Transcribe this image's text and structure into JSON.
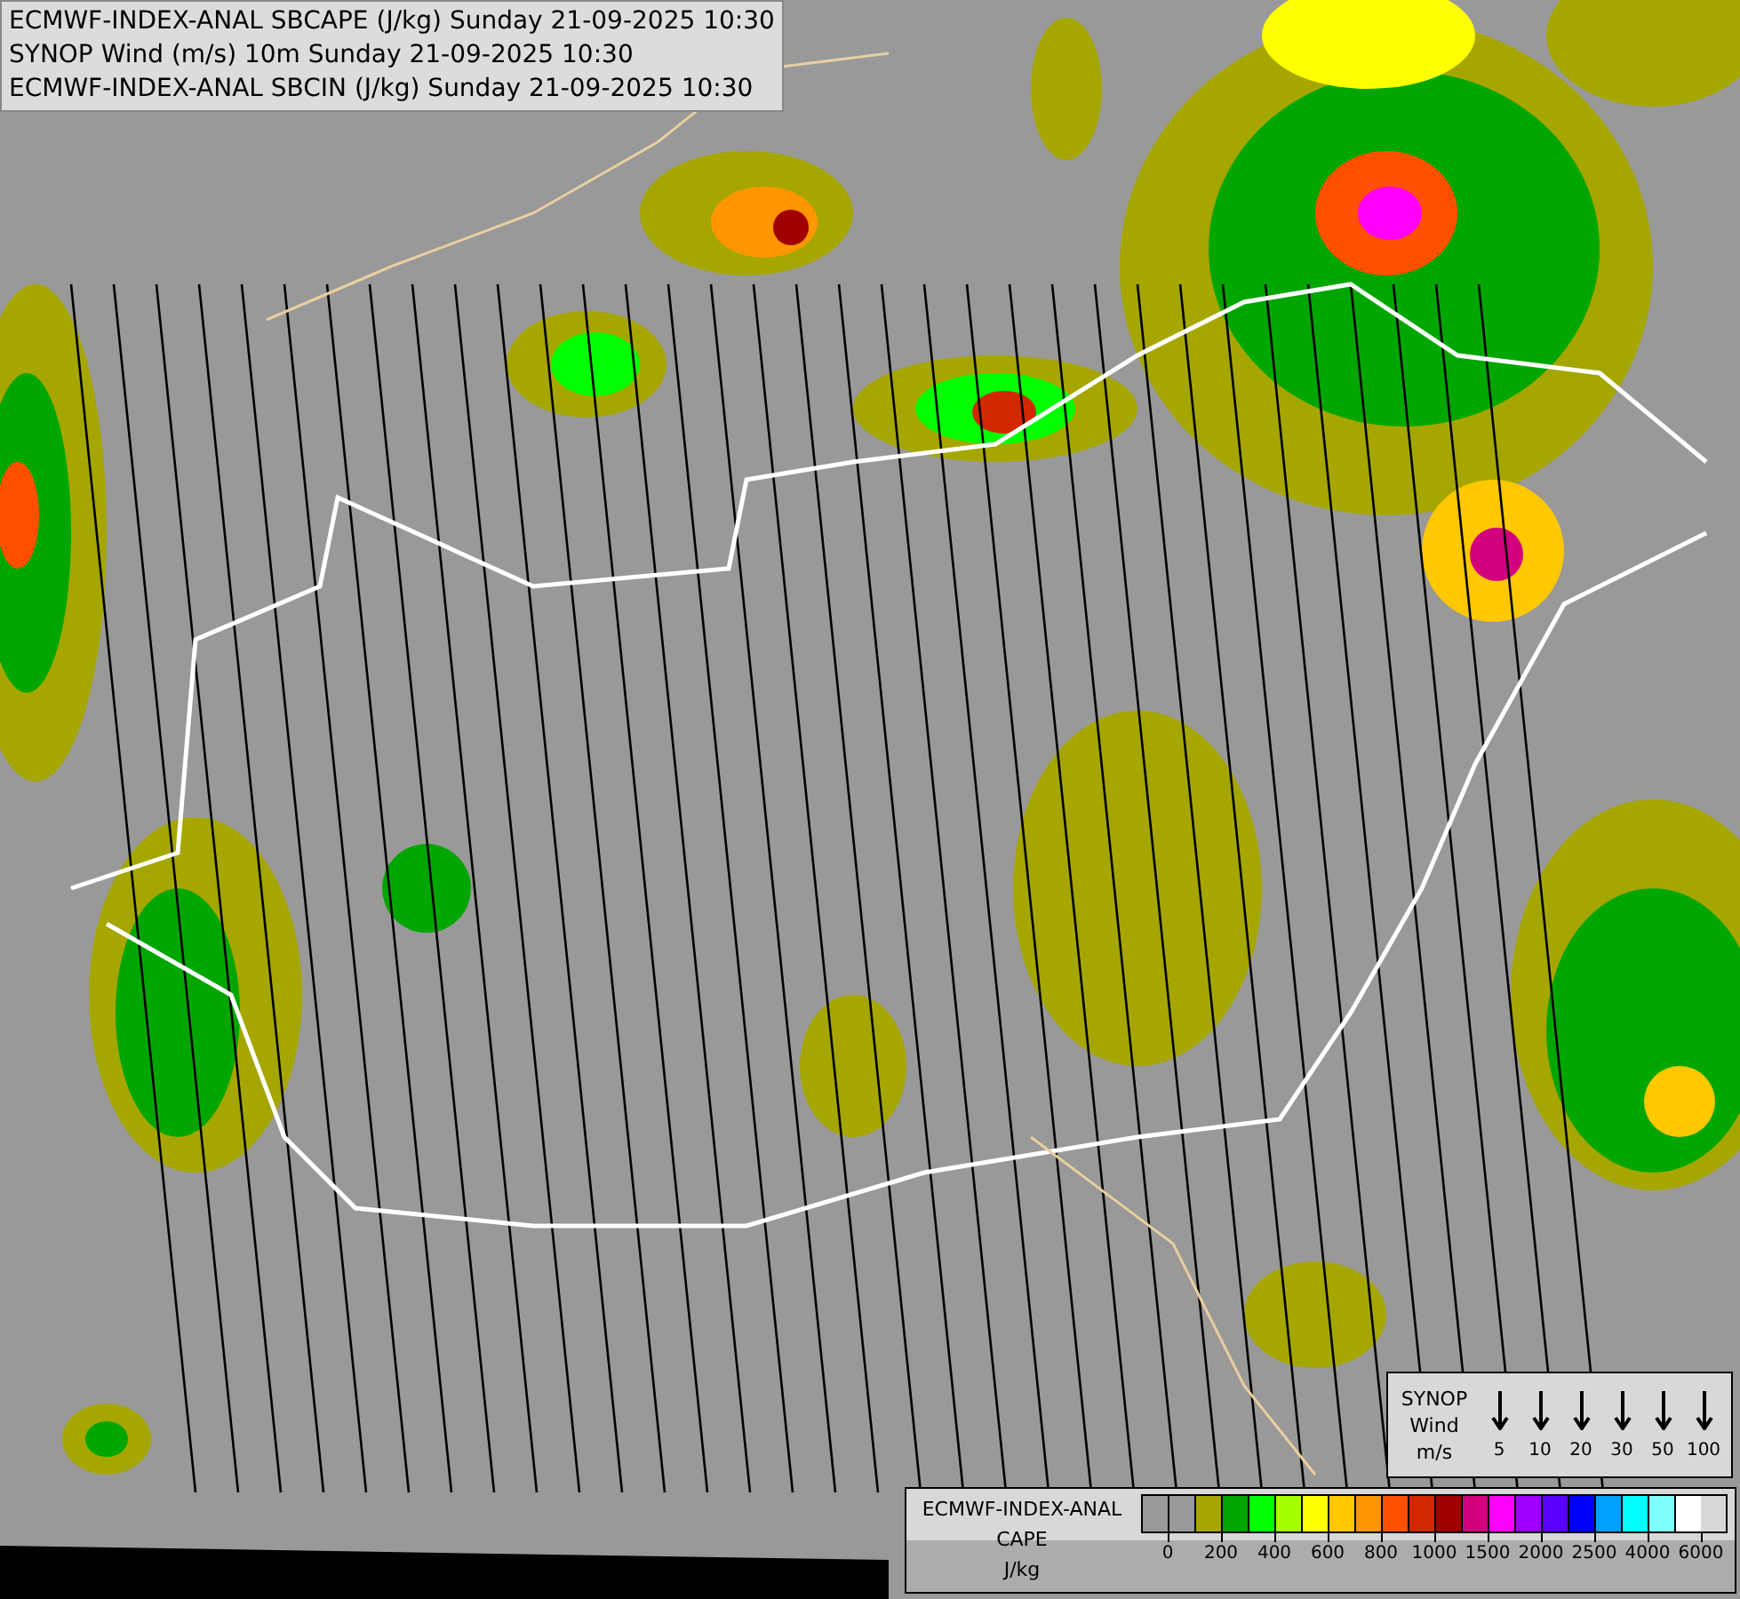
{
  "header": {
    "lines": [
      "ECMWF-INDEX-ANAL SBCAPE (J/kg) Sunday 21-09-2025 10:30",
      "SYNOP Wind (m/s) 10m Sunday 21-09-2025 10:30",
      "ECMWF-INDEX-ANAL SBCIN (J/kg) Sunday 21-09-2025 10:30"
    ]
  },
  "wind_legend": {
    "title_lines": [
      "SYNOP",
      "Wind",
      "m/s"
    ],
    "speeds": [
      "5",
      "10",
      "20",
      "30",
      "50",
      "100"
    ]
  },
  "cape_legend": {
    "title_lines": [
      "ECMWF-INDEX-ANAL",
      "CAPE",
      "J/kg"
    ],
    "swatches": [
      {
        "color": "#999999"
      },
      {
        "color": "#999999"
      },
      {
        "color": "#a6a600"
      },
      {
        "color": "#00a600"
      },
      {
        "color": "#00ff00"
      },
      {
        "color": "#a6ff00"
      },
      {
        "color": "#ffff00"
      },
      {
        "color": "#ffc800"
      },
      {
        "color": "#ff9600"
      },
      {
        "color": "#ff5000"
      },
      {
        "color": "#d22800"
      },
      {
        "color": "#a00000"
      },
      {
        "color": "#d2007d"
      },
      {
        "color": "#ff00ff"
      },
      {
        "color": "#a000ff"
      },
      {
        "color": "#5a00ff"
      },
      {
        "color": "#0000ff"
      },
      {
        "color": "#00a0ff"
      },
      {
        "color": "#00ffff"
      },
      {
        "color": "#80ffff"
      },
      {
        "color": "#ffffff"
      }
    ],
    "ticks": [
      "0",
      "200",
      "400",
      "600",
      "800",
      "1000",
      "1500",
      "2000",
      "2500",
      "4000",
      "6000"
    ]
  }
}
